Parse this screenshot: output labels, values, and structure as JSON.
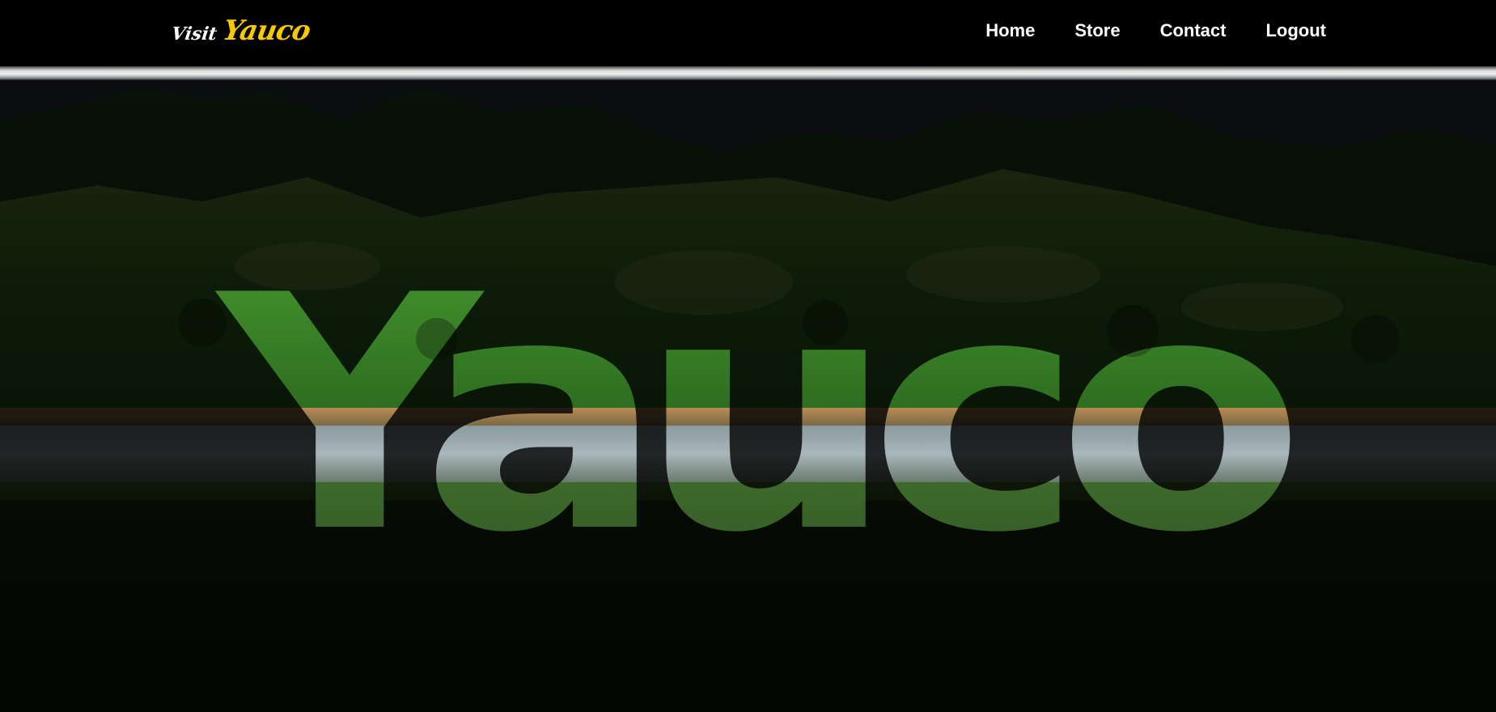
{
  "logo": {
    "prefix": "Visit",
    "name": "Yauco",
    "accent_color": "#f5c800"
  },
  "nav": {
    "items": [
      {
        "label": "Home"
      },
      {
        "label": "Store"
      },
      {
        "label": "Contact"
      },
      {
        "label": "Logout"
      }
    ]
  },
  "hero": {
    "title": "Yauco"
  }
}
